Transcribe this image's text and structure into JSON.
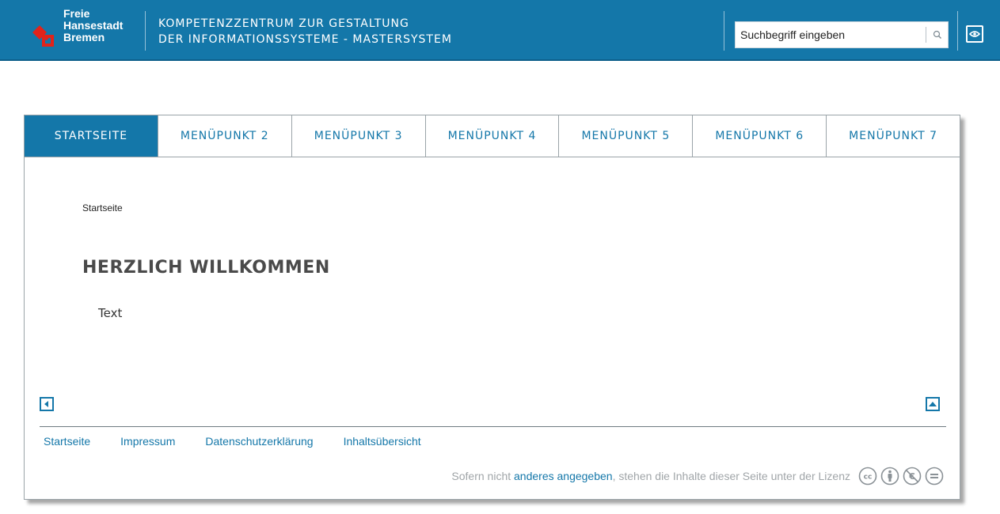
{
  "header": {
    "logo_lines": [
      "Freie",
      "Hansestadt",
      "Bremen"
    ],
    "title_line1": "KOMPETENZZENTRUM ZUR GESTALTUNG",
    "title_line2": "DER INFORMATIONSSYSTEME - MASTERSYSTEM",
    "search": {
      "placeholder": "Suchbegriff eingeben",
      "icon": "search-icon"
    },
    "accessibility_icon": "eye-icon"
  },
  "nav": {
    "items": [
      {
        "label": "STARTSEITE",
        "active": true
      },
      {
        "label": "MENÜPUNKT 2",
        "active": false
      },
      {
        "label": "MENÜPUNKT 3",
        "active": false
      },
      {
        "label": "MENÜPUNKT 4",
        "active": false
      },
      {
        "label": "MENÜPUNKT 5",
        "active": false
      },
      {
        "label": "MENÜPUNKT 6",
        "active": false
      },
      {
        "label": "MENÜPUNKT 7",
        "active": false
      }
    ]
  },
  "main": {
    "breadcrumb": "Startseite",
    "title": "HERZLICH WILLKOMMEN",
    "text": "Text"
  },
  "footer": {
    "links": [
      "Startseite",
      "Impressum",
      "Datenschutzerklärung",
      "Inhaltsübersicht"
    ],
    "license_prefix": "Sofern nicht ",
    "license_link": "anderes angegeben",
    "license_suffix": ", stehen die Inhalte dieser Seite unter der Lizenz",
    "license_icons": [
      "cc-icon",
      "by-icon",
      "nc-icon",
      "nd-icon"
    ]
  },
  "colors": {
    "brand_blue": "#1477a9",
    "logo_red": "#e2231a",
    "muted_text": "#a0a5a8"
  }
}
